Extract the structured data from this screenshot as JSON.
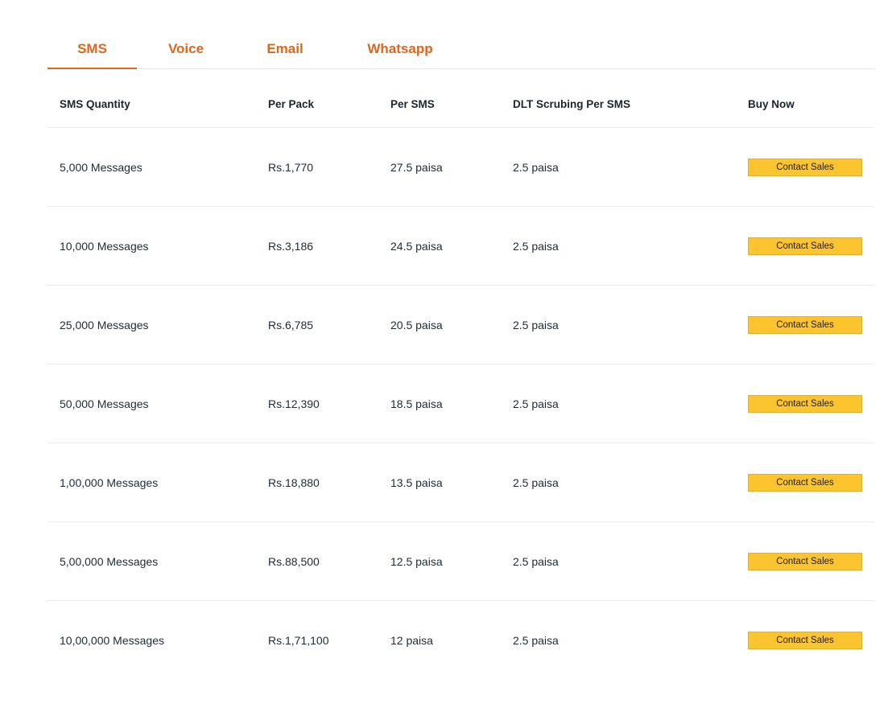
{
  "tabs": [
    {
      "label": "SMS",
      "active": true
    },
    {
      "label": "Voice",
      "active": false
    },
    {
      "label": "Email",
      "active": false
    },
    {
      "label": "Whatsapp",
      "active": false
    }
  ],
  "table": {
    "headers": [
      "SMS Quantity",
      "Per Pack",
      "Per SMS",
      "DLT Scrubing Per SMS",
      "Buy Now"
    ],
    "rows": [
      {
        "quantity": "5,000 Messages",
        "per_pack": "Rs.1,770",
        "per_sms": "27.5 paisa",
        "dlt": "2.5 paisa",
        "button": "Contact Sales"
      },
      {
        "quantity": "10,000 Messages",
        "per_pack": "Rs.3,186",
        "per_sms": "24.5 paisa",
        "dlt": "2.5 paisa",
        "button": "Contact Sales"
      },
      {
        "quantity": "25,000 Messages",
        "per_pack": "Rs.6,785",
        "per_sms": "20.5 paisa",
        "dlt": "2.5 paisa",
        "button": "Contact Sales"
      },
      {
        "quantity": "50,000 Messages",
        "per_pack": "Rs.12,390",
        "per_sms": "18.5 paisa",
        "dlt": "2.5 paisa",
        "button": "Contact Sales"
      },
      {
        "quantity": "1,00,000 Messages",
        "per_pack": "Rs.18,880",
        "per_sms": "13.5 paisa",
        "dlt": "2.5 paisa",
        "button": "Contact Sales"
      },
      {
        "quantity": "5,00,000 Messages",
        "per_pack": "Rs.88,500",
        "per_sms": "12.5 paisa",
        "dlt": "2.5 paisa",
        "button": "Contact Sales"
      },
      {
        "quantity": "10,00,000 Messages",
        "per_pack": "Rs.1,71,100",
        "per_sms": "12 paisa",
        "dlt": "2.5 paisa",
        "button": "Contact Sales"
      }
    ]
  },
  "colors": {
    "accent": "#e0661a",
    "button_bg": "#fcc52f"
  }
}
